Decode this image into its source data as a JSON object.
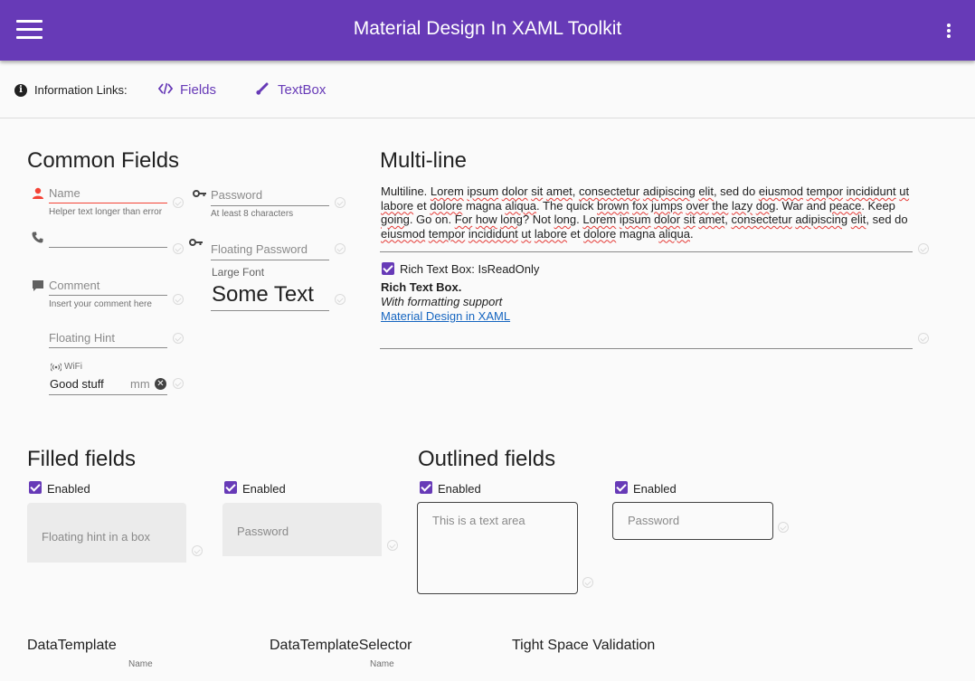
{
  "appbar": {
    "title": "Material Design In XAML Toolkit",
    "menu_icon": "hamburger-menu-icon",
    "more_icon": "more-vert-icon"
  },
  "info": {
    "label": "Information Links:",
    "links": [
      {
        "label": "Fields",
        "icon": "code-tags-icon"
      },
      {
        "label": "TextBox",
        "icon": "brush-icon"
      }
    ]
  },
  "common": {
    "title": "Common Fields",
    "name": {
      "hint": "Name",
      "helper": "Helper text longer than error"
    },
    "password": {
      "hint": "Password",
      "helper": "At least 8 characters"
    },
    "phone": {
      "value": ""
    },
    "floating_password": {
      "hint": "Floating Password"
    },
    "comment": {
      "hint": "Comment",
      "helper": "Insert your comment here"
    },
    "large_font": {
      "label": "Large Font",
      "value": "Some Text"
    },
    "floating_hint": {
      "hint": "Floating Hint"
    },
    "wifi": {
      "label": "WiFi",
      "value": "Good stuff",
      "suffix": "mm"
    }
  },
  "multiline": {
    "title": "Multi-line",
    "text": "Multiline. Lorem ipsum dolor sit amet, consectetur adipiscing elit, sed do eiusmod tempor incididunt ut labore et dolore magna aliqua. The quick brown fox jumps over the lazy dog. War and peace. Keep going. Go on. For how long? Not long. Lorem ipsum dolor sit amet, consectetur adipiscing elit, sed do eiusmod tempor incididunt ut labore et dolore magna aliqua.",
    "readonly_label": "Rich Text Box: IsReadOnly",
    "rich_bold": "Rich Text Box.",
    "rich_italic": "With formatting support",
    "rich_link": "Material Design in XAML"
  },
  "filled": {
    "title": "Filled fields",
    "enabled_1": "Enabled",
    "enabled_2": "Enabled",
    "hint_1": "Floating hint in a box",
    "hint_2": "Password"
  },
  "outlined": {
    "title": "Outlined fields",
    "enabled_1": "Enabled",
    "enabled_2": "Enabled",
    "hint_1": "This is a text area",
    "hint_2": "Password"
  },
  "bottom": {
    "datatemplate": "DataTemplate",
    "datatemplate_sub": "Name",
    "selector": "DataTemplateSelector",
    "selector_sub": "Name",
    "tight": "Tight Space Validation"
  },
  "colors": {
    "primary": "#673ab7",
    "error": "#f44336",
    "link": "#1565c0"
  }
}
